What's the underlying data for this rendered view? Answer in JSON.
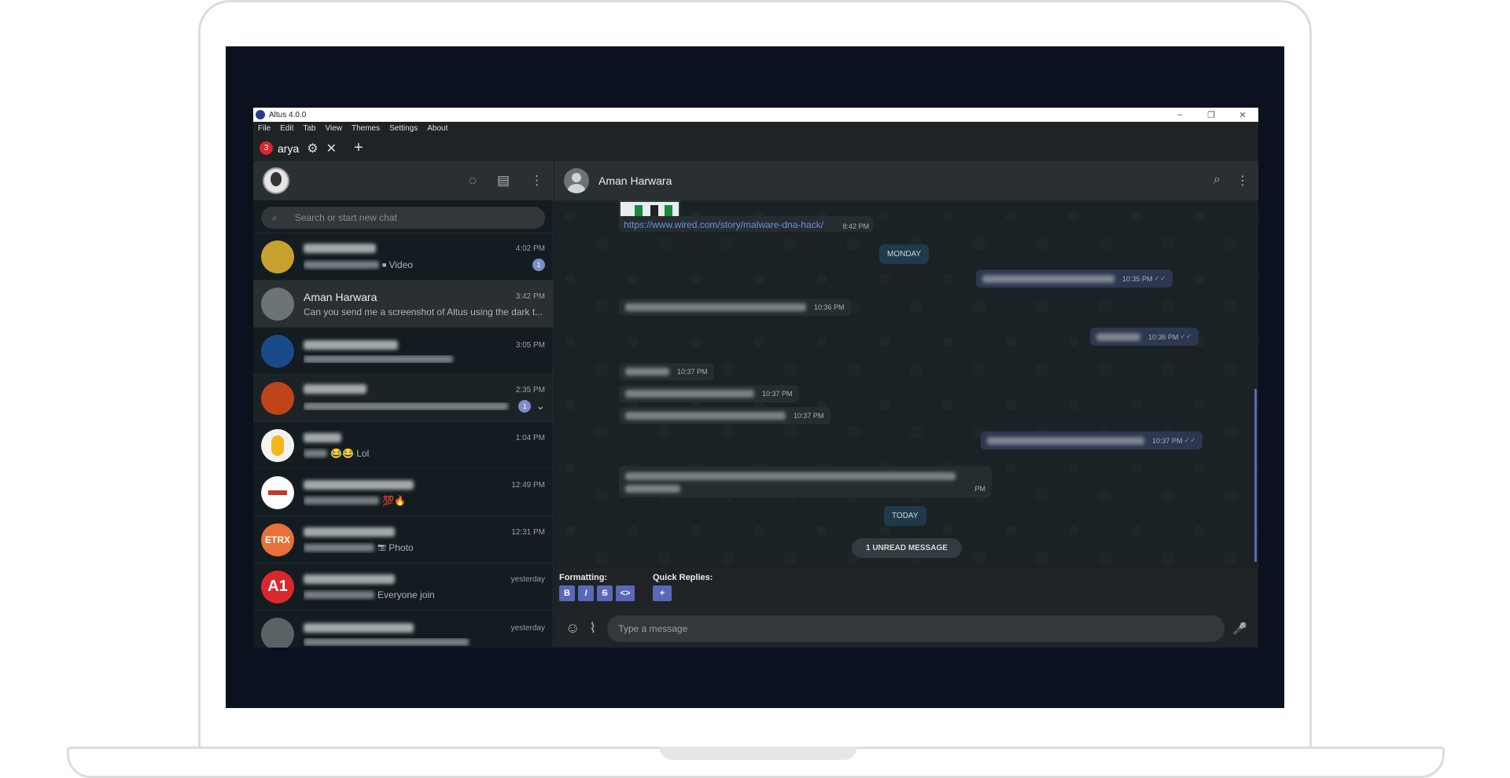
{
  "window": {
    "title": "Altus 4.0.0",
    "minimize": "–",
    "maximize": "❐",
    "close": "✕"
  },
  "menu": [
    "File",
    "Edit",
    "Tab",
    "View",
    "Themes",
    "Settings",
    "About"
  ],
  "tab": {
    "badge": "3",
    "label": "arya",
    "gear": "⚙",
    "close": "✕",
    "add": "+"
  },
  "sidebar": {
    "icons": {
      "status": "◌",
      "new_chat": "▤",
      "menu": "⋮"
    },
    "search": {
      "icon": "⌕",
      "placeholder": "Search or start new chat"
    },
    "chats": [
      {
        "name": "",
        "time": "4:02 PM",
        "preview": "Video",
        "preview_icon": "■",
        "unread": "1",
        "avatar_color": "#c8a030"
      },
      {
        "name": "Aman Harwara",
        "time": "3:42 PM",
        "preview": "Can you send me a screenshot of Altus using the dark t...",
        "unread": "",
        "avatar_color": "#6b7376"
      },
      {
        "name": "",
        "time": "3:05 PM",
        "preview": "",
        "unread": "",
        "avatar_color": "#1b4a8a"
      },
      {
        "name": "",
        "time": "2:35 PM",
        "preview": "",
        "unread": "1",
        "chevron": "⌄",
        "avatar_color": "#c0441a"
      },
      {
        "name": "",
        "time": "1:04 PM",
        "preview": "😂😂 Lol",
        "unread": "",
        "avatar_color": "#f2f2f2"
      },
      {
        "name": "",
        "time": "12:49 PM",
        "preview": "💯🔥",
        "unread": "",
        "avatar_color": "#ffffff"
      },
      {
        "name": "",
        "time": "12:31 PM",
        "preview": "Photo",
        "preview_icon": "📷",
        "unread": "",
        "avatar_color": "#e8703a",
        "avatar_text": "ETRX"
      },
      {
        "name": "",
        "time": "yesterday",
        "preview": "Everyone join",
        "unread": "",
        "avatar_color": "#d9272e",
        "avatar_text": "A1"
      },
      {
        "name": "",
        "time": "yesterday",
        "preview": "",
        "unread": "",
        "avatar_color": "#5a6266"
      }
    ]
  },
  "chat": {
    "contact_name": "Aman Harwara",
    "icons": {
      "search": "⌕",
      "menu": "⋮"
    },
    "link_text": "https://www.wired.com/story/malware-dna-hack/",
    "link_time": "8:42 PM",
    "day_monday": "MONDAY",
    "day_today": "TODAY",
    "unread_banner": "1 UNREAD MESSAGE",
    "messages": [
      {
        "time": "10:35 PM",
        "tick": "✓✓"
      },
      {
        "time": "10:36 PM"
      },
      {
        "time": "10:36 PM",
        "tick": "✓✓"
      },
      {
        "time": "10:37 PM"
      },
      {
        "time": "10:37 PM"
      },
      {
        "time": "10:37 PM"
      },
      {
        "time": "10:37 PM",
        "tick": "✓✓"
      },
      {
        "time": "PM"
      }
    ],
    "formatting_label": "Formatting:",
    "quick_replies_label": "Quick Replies:",
    "format_buttons": {
      "bold": "B",
      "italic": "I",
      "strike": "S",
      "code": "<>",
      "add": "+"
    },
    "compose": {
      "emoji": "☺",
      "attach": "⌇",
      "placeholder": "Type a message",
      "mic": "🎤"
    }
  }
}
